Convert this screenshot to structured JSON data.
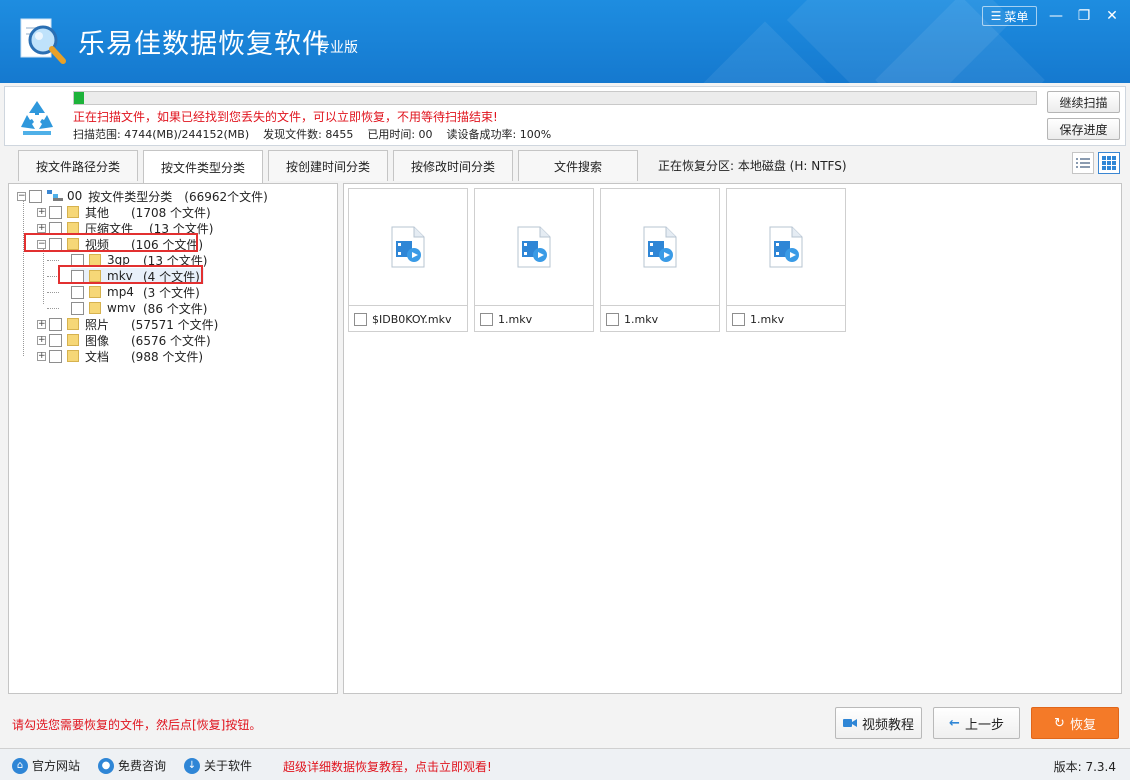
{
  "app": {
    "title": "乐易佳数据恢复软件",
    "edition": "专业版",
    "menu_label": "菜单"
  },
  "scan": {
    "message": "正在扫描文件，如果已经找到您丢失的文件，可以立即恢复，不用等待扫描结束!",
    "range": "扫描范围: 4744(MB)/244152(MB)",
    "found": "发现文件数: 8455",
    "elapsed": "已用时间: 00",
    "read_rate": "读设备成功率: 100%",
    "progress_fraction": 0.01,
    "continue_label": "继续扫描",
    "save_label": "保存进度"
  },
  "tabs": [
    {
      "label": "按文件路径分类",
      "active": false
    },
    {
      "label": "按文件类型分类",
      "active": true
    },
    {
      "label": "按创建时间分类",
      "active": false
    },
    {
      "label": "按修改时间分类",
      "active": false
    },
    {
      "label": "文件搜索",
      "active": false
    }
  ],
  "recover_partition": "正在恢复分区: 本地磁盘 (H: NTFS)",
  "tree": {
    "root": {
      "id": "00",
      "label": "按文件类型分类",
      "count": "(66962个文件)"
    },
    "items": [
      {
        "label": "其他",
        "count": "(1708 个文件)"
      },
      {
        "label": "压缩文件",
        "count": "(13 个文件)"
      },
      {
        "label": "视频",
        "count": "(106 个文件)"
      },
      {
        "label": "3gp",
        "count": "(13 个文件)"
      },
      {
        "label": "mkv",
        "count": "(4 个文件)"
      },
      {
        "label": "mp4",
        "count": "(3 个文件)"
      },
      {
        "label": "wmv",
        "count": "(86 个文件)"
      },
      {
        "label": "照片",
        "count": "(57571 个文件)"
      },
      {
        "label": "图像",
        "count": "(6576 个文件)"
      },
      {
        "label": "文档",
        "count": "(988 个文件)"
      }
    ]
  },
  "files": [
    {
      "name": "$IDB0KOY.mkv"
    },
    {
      "name": "1.mkv"
    },
    {
      "name": "1.mkv"
    },
    {
      "name": "1.mkv"
    }
  ],
  "bottom": {
    "hint": "请勾选您需要恢复的文件，然后点[恢复]按钮。",
    "video_tutorial": "视频教程",
    "prev_step": "上一步",
    "recover": "恢复"
  },
  "status": {
    "website": "官方网站",
    "consult": "免费咨询",
    "about": "关于软件",
    "promo": "超级详细数据恢复教程，点击立即观看!",
    "version": "版本: 7.3.4"
  },
  "colors": {
    "titlebar": "#1a84da",
    "accent_red": "#e0141e",
    "recover_orange": "#f47a28",
    "progress_green": "#1db33a"
  }
}
